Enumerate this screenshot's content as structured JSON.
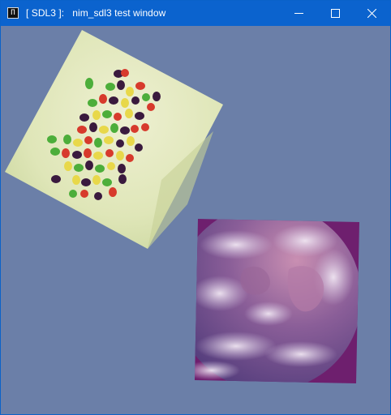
{
  "window": {
    "title": "[ SDL3 ]:   nim_sdl3 test window",
    "icon": "app-icon",
    "icon_glyph": "П",
    "background_color": "#6b7fa8",
    "titlebar_color": "#0b63ce"
  },
  "controls": {
    "minimize": "minimize-icon",
    "maximize": "maximize-icon",
    "close": "close-icon"
  },
  "sprites": [
    {
      "name": "jelly-beans-image",
      "rotation": "rotated ~30°"
    },
    {
      "name": "earth-image"
    }
  ]
}
